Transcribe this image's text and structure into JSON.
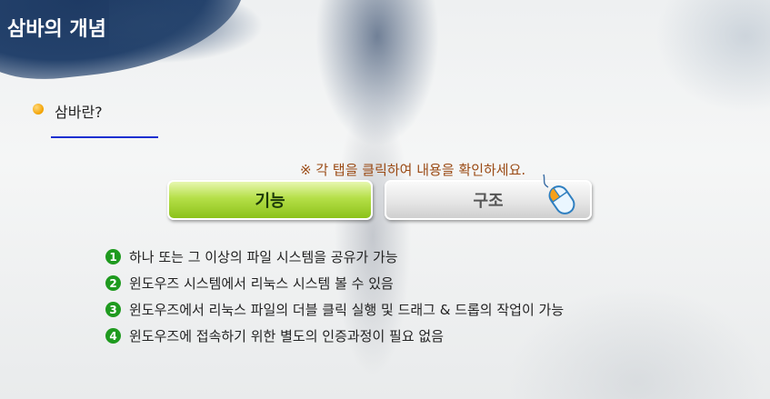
{
  "header": {
    "title": "삼바의 개념"
  },
  "section": {
    "label": "삼바란?"
  },
  "notice": {
    "text": "※ 각 탭을 클릭하여 내용을 확인하세요."
  },
  "tabs": [
    {
      "label": "기능",
      "active": true
    },
    {
      "label": "구조",
      "active": false
    }
  ],
  "list": [
    {
      "num": "1",
      "text": "하나 또는 그 이상의 파일 시스템을 공유가 가능"
    },
    {
      "num": "2",
      "text": "윈도우즈 시스템에서 리눅스 시스템 볼 수 있음"
    },
    {
      "num": "3",
      "text": "윈도우즈에서 리눅스 파일의 더블 클릭 실행 및 드래그 & 드롭의 작업이 가능"
    },
    {
      "num": "4",
      "text": "윈도우즈에 접속하기 위한 별도의 인증과정이 필요 없음"
    }
  ],
  "colors": {
    "header_bg": "#24426c",
    "active_tab": "#9ccf2b",
    "inactive_tab": "#e0e0e0",
    "number_badge": "#1f9a1f",
    "notice_text": "#9a4a14",
    "underline": "#1a2fd0"
  },
  "icons": {
    "section_bullet": "orange-dot-icon",
    "cursor": "mouse-icon"
  }
}
